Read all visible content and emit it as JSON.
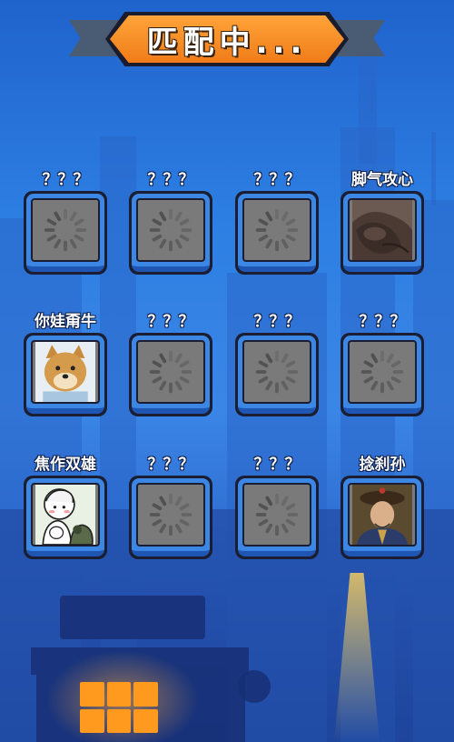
{
  "header": {
    "title": "匹配中..."
  },
  "slots": [
    {
      "label": "？？？",
      "state": "loading"
    },
    {
      "label": "？？？",
      "state": "loading"
    },
    {
      "label": "？？？",
      "state": "loading"
    },
    {
      "label": "脚气攻心",
      "state": "player",
      "avatar": "hand-avatar"
    },
    {
      "label": "你娃甭牛",
      "state": "player",
      "avatar": "dog-avatar"
    },
    {
      "label": "？？？",
      "state": "loading"
    },
    {
      "label": "？？？",
      "state": "loading"
    },
    {
      "label": "？？？",
      "state": "loading"
    },
    {
      "label": "焦作双雄",
      "state": "player",
      "avatar": "cartoon-avatar"
    },
    {
      "label": "？？？",
      "state": "loading"
    },
    {
      "label": "？？？",
      "state": "loading"
    },
    {
      "label": "捻刹孙",
      "state": "player",
      "avatar": "official-avatar"
    }
  ],
  "footer": {
    "menu_icon": "grid-menu-icon"
  },
  "colors": {
    "accent": "#f07c18",
    "slot_blue": "#3c86e4",
    "loading_gray": "#7a7a7a"
  }
}
